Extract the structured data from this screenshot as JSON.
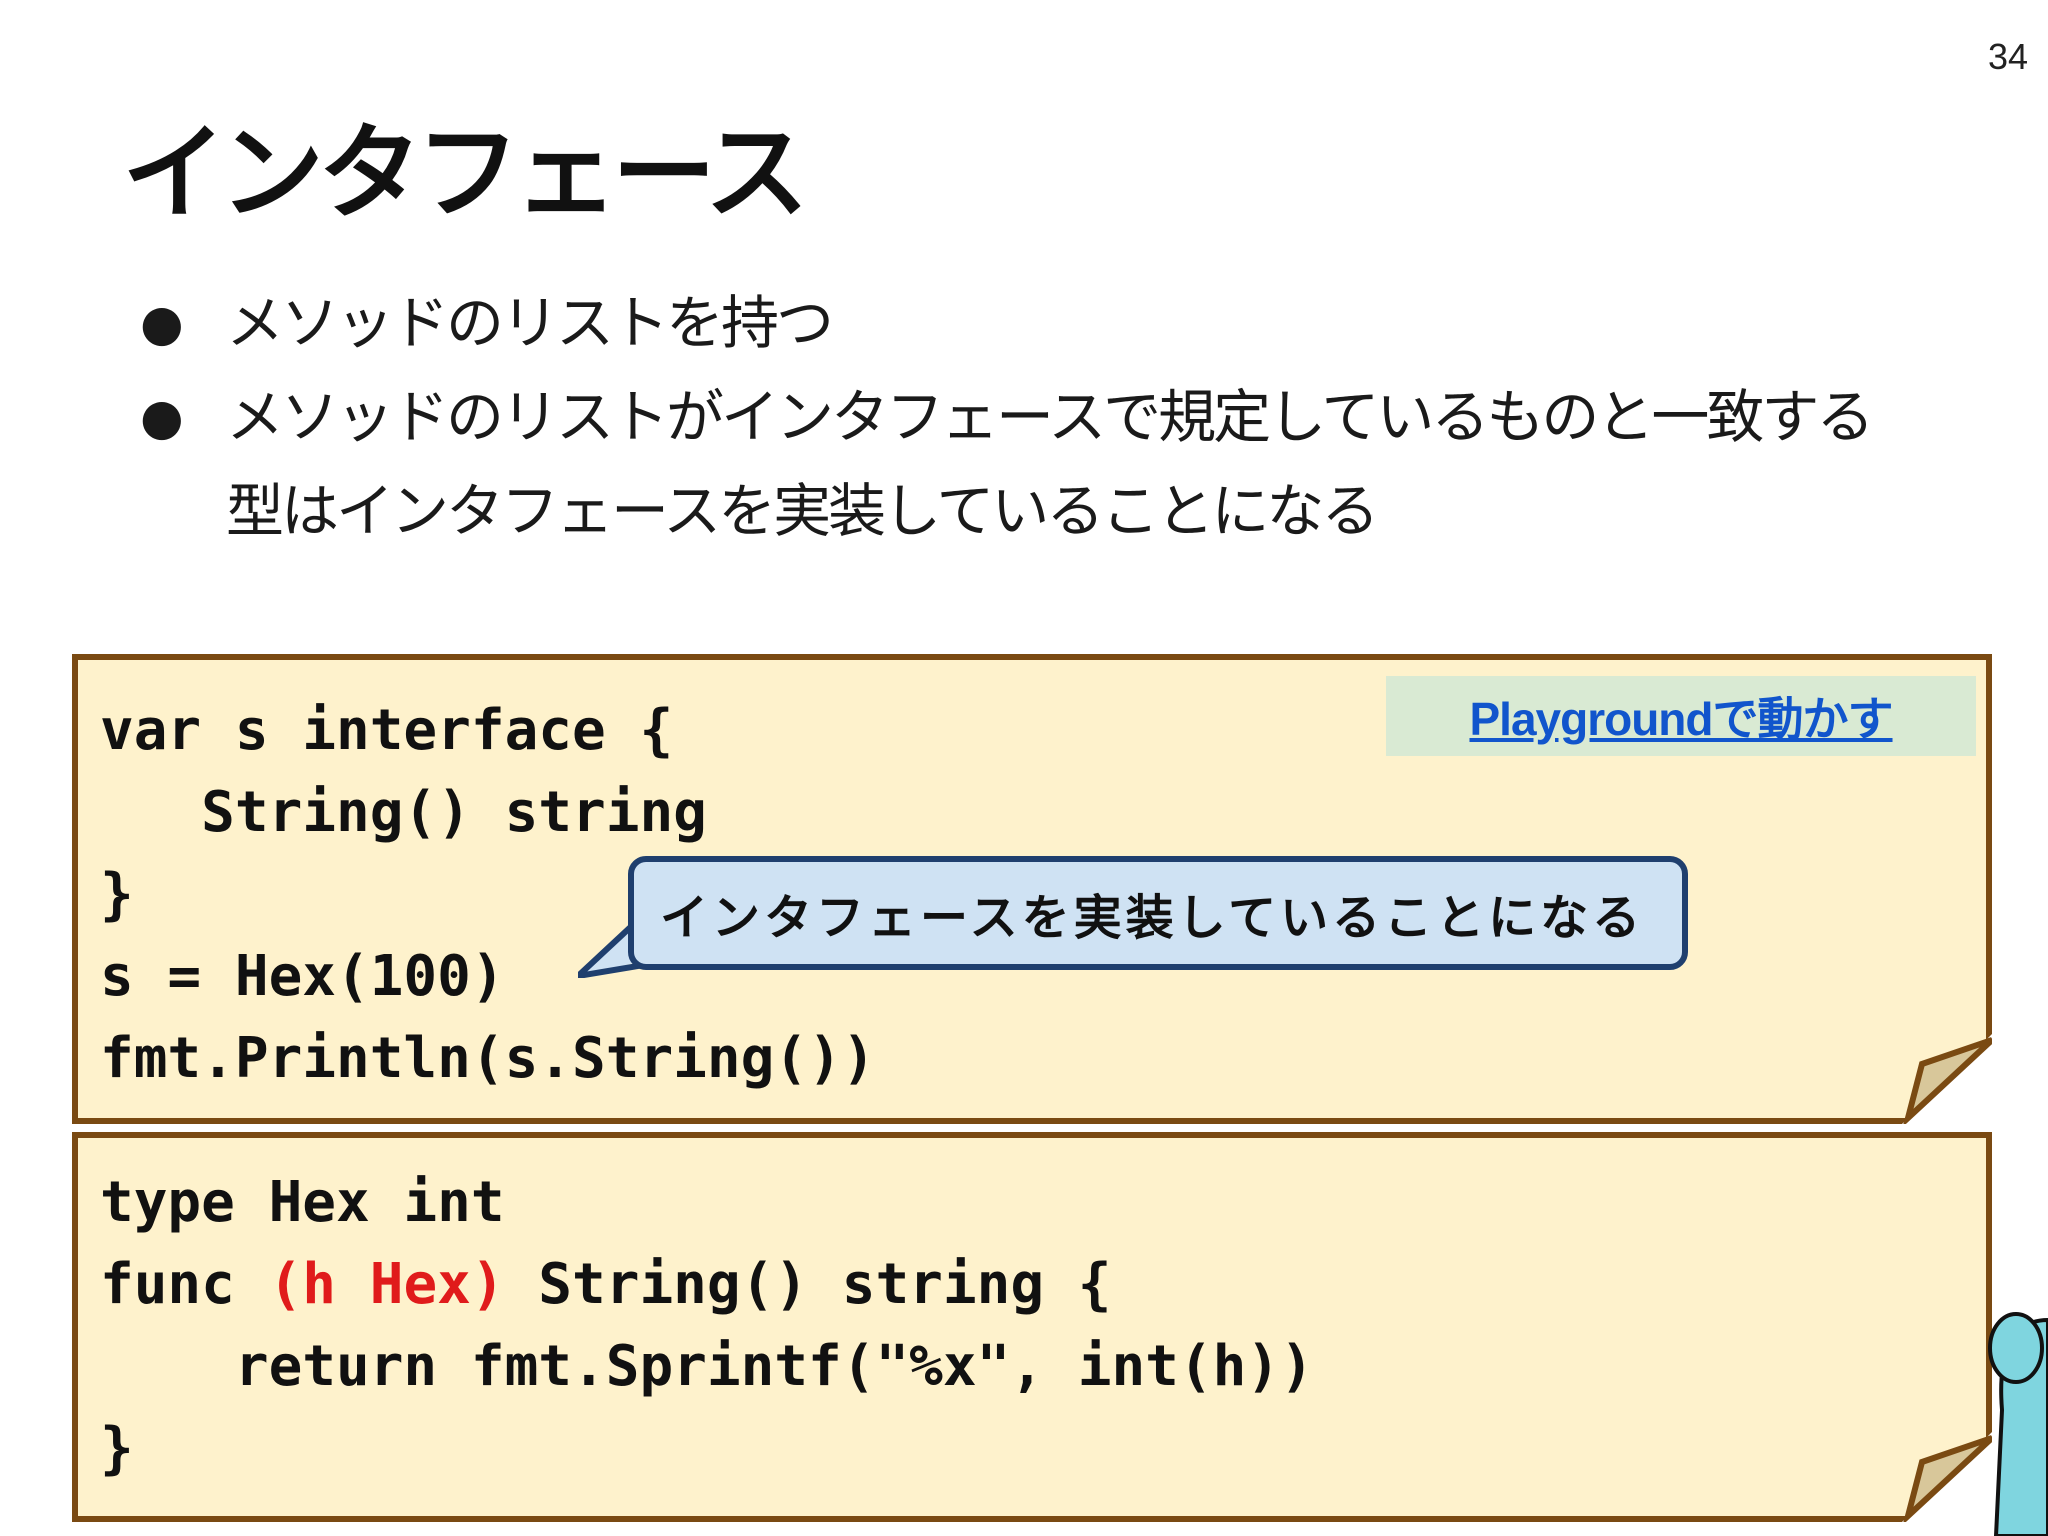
{
  "slide": {
    "page_number": "34",
    "title": "インタフェース",
    "bullets": [
      "メソッドのリストを持つ",
      "メソッドのリストがインタフェースで規定しているものと一致する型はインタフェースを実装していることになる"
    ]
  },
  "code_block_1": {
    "playground_link": "Playgroundで動かす",
    "lines": [
      "var s interface {",
      "   String() string",
      "}",
      "s = Hex(100)",
      "fmt.Println(s.String())"
    ]
  },
  "callout": {
    "text": "インタフェースを実装していることになる"
  },
  "code_block_2": {
    "line1": "type Hex int",
    "line2_prefix": "func ",
    "line2_receiver": "(h Hex)",
    "line2_suffix": " String() string {",
    "line3": "    return fmt.Sprintf(\"%x\", int(h))",
    "line4": "}"
  },
  "colors": {
    "card_bg": "#fef2cc",
    "card_border": "#7a4a12",
    "highlight": "#e01b1b",
    "link": "#1155cc",
    "callout_bg": "#cfe2f3",
    "callout_border": "#1f3f6e"
  }
}
